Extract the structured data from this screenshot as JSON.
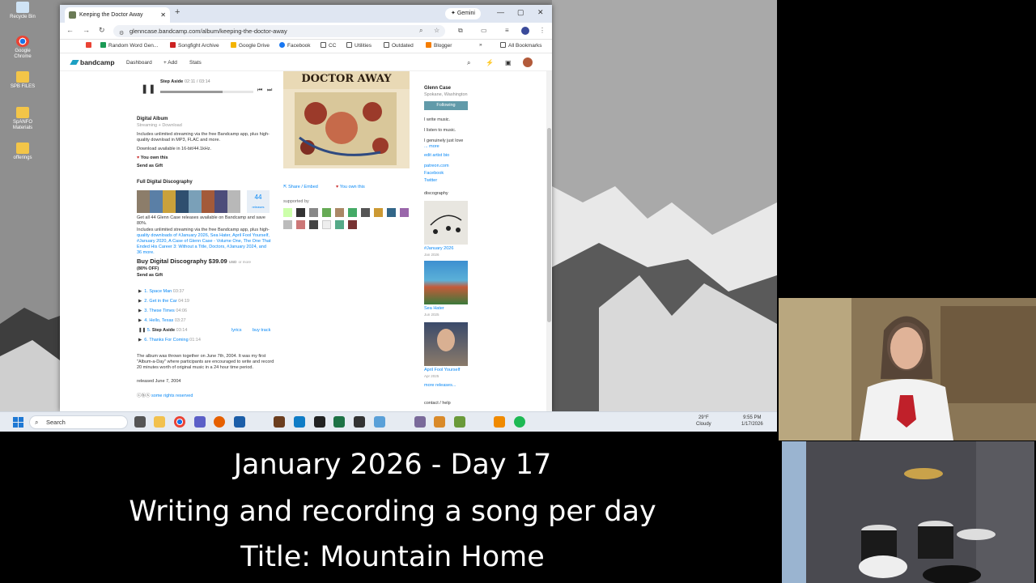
{
  "desktop": {
    "icons": [
      {
        "label": "Recycle Bin",
        "name": "recycle-bin-icon"
      },
      {
        "label": "Google Chrome",
        "name": "chrome-icon"
      },
      {
        "label": "SPB FILES",
        "name": "folder-icon"
      },
      {
        "label": "SpANFO Materials",
        "name": "folder-icon"
      },
      {
        "label": "offerings",
        "name": "folder-icon"
      }
    ]
  },
  "browser": {
    "tab_title": "Keeping the Doctor Away",
    "gemini_label": "Gemini",
    "url": "glenncase.bandcamp.com/album/keeping-the-doctor-away",
    "bookmarks": [
      "Random Word Gen...",
      "Songfight Archive",
      "Google Drive",
      "Facebook",
      "CC",
      "Utilities",
      "Outdated",
      "Blogger"
    ],
    "all_bookmarks": "All Bookmarks"
  },
  "bandcamp": {
    "logo": "bandcamp",
    "nav": [
      "Dashboard",
      "Add",
      "Stats"
    ],
    "player": {
      "track": "Step Aside",
      "time": "02:11 / 03:14"
    },
    "digital_album": {
      "title": "Digital Album",
      "subtitle": "Streaming + Download",
      "desc1": "Includes unlimited streaming via the free Bandcamp app, plus high-",
      "desc2": "quality download in MP3, FLAC and more.",
      "available": "Download available in 16-bit/44.1kHz.",
      "own": "You own this",
      "gift": "Send as Gift"
    },
    "discography": {
      "title": "Full Digital Discography",
      "count": "44",
      "count_label": "releases",
      "get_all": "Get all 44 Glenn Case releases available on Bandcamp and save",
      "save": "80%.",
      "inc1": "Includes unlimited streaming via the free Bandcamp app, plus high-",
      "inc2": "quality downloads of #January 2026, Sea Hater, April Fool Yourself,",
      "inc3": "#January 2020, A Case of Glenn Case - Volume One, The One That",
      "inc4": "Ended His Career 3: Without a Title, Doctors, #January 2024, and",
      "inc5": "36 more.",
      "buy": "Buy Digital Discography",
      "price": "$39.09",
      "currency": "USD",
      "or_more": "or more",
      "off": "(80% OFF)",
      "gift": "Send as Gift"
    },
    "tracks": [
      {
        "num": "1.",
        "title": "Space Man",
        "time": "03:37"
      },
      {
        "num": "2.",
        "title": "Get in the Car",
        "time": "04:19"
      },
      {
        "num": "3.",
        "title": "These Times",
        "time": "04:06"
      },
      {
        "num": "4.",
        "title": "Hello, Texas",
        "time": "03:27"
      },
      {
        "num": "5.",
        "title": "Step Aside",
        "time": "03:14"
      },
      {
        "num": "6.",
        "title": "Thanks For Coming",
        "time": "01:14"
      }
    ],
    "lyrics": "lyrics",
    "buy_track": "buy track",
    "about1": "The album was thrown together on June 7th, 2004. It was my first",
    "about2": "\"Album-a-Day\" where participants are encouraged to write and record",
    "about3": "20 minutes worth of original music in a 24 hour time period.",
    "released": "released June 7, 2004",
    "rights": "some rights reserved",
    "art_text": "DOCTOR AWAY",
    "share": "Share / Embed",
    "own_this": "You own this",
    "supported_by": "supported by",
    "artist": {
      "name": "Glenn Case",
      "location": "Spokane, Washington",
      "following": "Following",
      "bio1": "I write music.",
      "bio2": "I listen to music.",
      "bio3": "I genuinely just love",
      "more": "... more",
      "edit": "edit artist bio",
      "links": [
        "patreon.com",
        "Facebook",
        "Twitter"
      ],
      "discography_label": "discography",
      "releases": [
        {
          "title": "#January 2026",
          "date": "Jan 2026"
        },
        {
          "title": "Sea Hater",
          "date": "Jun 2025"
        },
        {
          "title": "April Fool Yourself",
          "date": "Apr 2025"
        }
      ],
      "more_releases": "more releases...",
      "contact": "contact / help"
    }
  },
  "taskbar": {
    "search": "Search",
    "weather_temp": "29°F",
    "weather_desc": "Cloudy",
    "time": "9:55 PM",
    "date": "1/17/2026"
  },
  "caption": {
    "line1": "January 2026 - Day 17",
    "line2": "Writing and recording a song per day",
    "line3": "Title: Mountain Home"
  }
}
